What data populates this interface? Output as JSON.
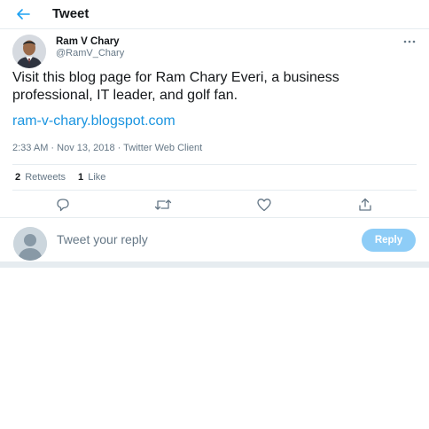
{
  "header": {
    "title": "Tweet"
  },
  "author": {
    "name": "Ram V Chary",
    "handle": "@RamV_Chary"
  },
  "tweet": {
    "text": "Visit this blog page for Ram Chary Everi, a business professional, IT leader, and golf fan.",
    "link": "ram-v-chary.blogspot.com",
    "meta": "2:33 AM · Nov 13, 2018 · Twitter Web Client"
  },
  "stats": {
    "retweets_count": "2",
    "retweets_label": "Retweets",
    "likes_count": "1",
    "likes_label": "Like"
  },
  "reply": {
    "placeholder": "Tweet your reply",
    "button_label": "Reply"
  },
  "colors": {
    "accent": "#1da1f2",
    "link": "#1b95e0",
    "reply_button": "#8ecdf7",
    "divider": "#e6ecf0",
    "secondary_text": "#657786"
  },
  "icons": [
    "back-arrow-icon",
    "more-icon",
    "reply-icon",
    "retweet-icon",
    "like-icon",
    "share-icon"
  ]
}
